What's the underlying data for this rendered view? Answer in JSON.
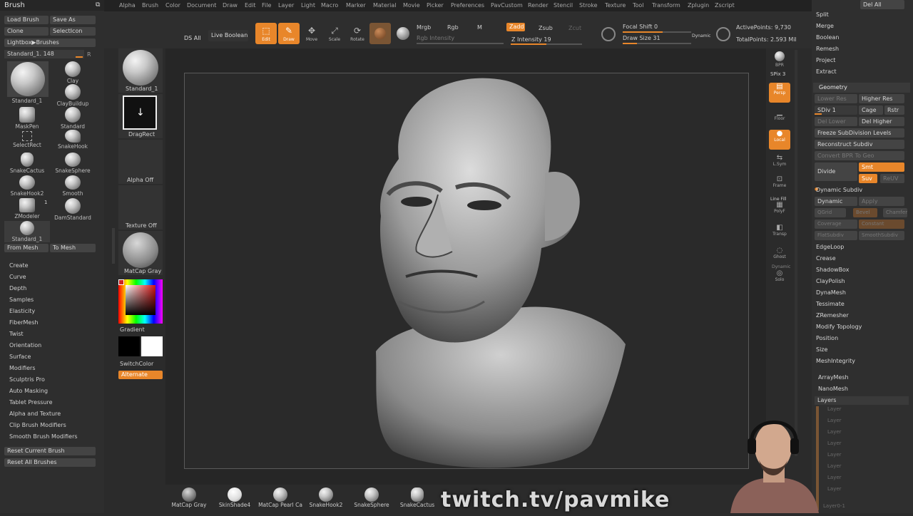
{
  "menu": [
    "Alpha",
    "Brush",
    "Color",
    "Document",
    "Draw",
    "Edit",
    "File",
    "Layer",
    "Light",
    "Macro",
    "Marker",
    "Material",
    "Movie",
    "Picker",
    "Preferences",
    "PavCustom",
    "Render",
    "Stencil",
    "Stroke",
    "Texture",
    "Tool",
    "Transform",
    "Zplugin",
    "Zscript"
  ],
  "left": {
    "title": "Brush",
    "load": "Load Brush",
    "saveas": "Save As",
    "clone": "Clone",
    "selecticon": "SelectIcon",
    "lightbox": "Lightbox▶Brushes",
    "current": "Standard_1. 148",
    "r": "R",
    "brushes": [
      "Standard_1",
      "Clay",
      "ClayBuildup",
      "MaskPen",
      "Standard",
      "SelectRect",
      "SnakeHook",
      "SnakeCactus",
      "SnakeSphere",
      "SnakeHook2",
      "Smooth",
      "ZModeler",
      "DamStandard",
      "Standard_1"
    ],
    "zmodeler_count": "1",
    "frommesh": "From Mesh",
    "tomesh": "To Mesh",
    "sections": [
      "Create",
      "Curve",
      "Depth",
      "Samples",
      "Elasticity",
      "FiberMesh",
      "Twist",
      "Orientation",
      "Surface",
      "Modifiers",
      "Sculptris Pro",
      "Auto Masking",
      "Tablet Pressure",
      "Alpha and Texture",
      "Clip Brush Modifiers",
      "Smooth Brush Modifiers"
    ],
    "reset_current": "Reset Current Brush",
    "reset_all": "Reset All Brushes"
  },
  "shelf": {
    "brush": "Standard_1",
    "stroke": "DragRect",
    "alpha": "Alpha Off",
    "texture": "Texture Off",
    "material": "MatCap Gray",
    "gradient": "Gradient",
    "switchcolor": "SwitchColor",
    "alternate": "Alternate"
  },
  "toolbar": {
    "ds_all": "DS All",
    "live_boolean": "Live Boolean",
    "edit": "Edit",
    "draw": "Draw",
    "move": "Move",
    "scale": "Scale",
    "rotate": "Rotate",
    "mrgb": "Mrgb",
    "rgb": "Rgb",
    "m": "M",
    "zadd": "Zadd",
    "zsub": "Zsub",
    "zcut": "Zcut",
    "rgb_intensity": "Rgb Intensity",
    "z_intensity": "Z Intensity 19",
    "focal": "Focal Shift 0",
    "drawsize": "Draw Size 31",
    "dynamic": "Dynamic",
    "active_points": "ActivePoints: 9,730",
    "total_points": "TotalPoints: 2.593 Mil"
  },
  "rightshelf": {
    "bpr": "BPR",
    "spix": "SPix 3",
    "persp": "Persp",
    "floor": "Floor",
    "local": "Local",
    "lsym": "L.Sym",
    "frame": "Frame",
    "polyf": "PolyF",
    "transp": "Transp",
    "ghost": "Ghost",
    "solo": "Solo",
    "dynamic": "Dynamic",
    "linefill": "Line Fill"
  },
  "right": {
    "delall": "Del All",
    "top_items": [
      "Split",
      "Merge",
      "Boolean",
      "Remesh",
      "Project",
      "Extract"
    ],
    "geometry": "Geometry",
    "lower_res": "Lower Res",
    "higher_res": "Higher Res",
    "sdiv": "SDiv 1",
    "cage": "Cage",
    "rstr": "Rstr",
    "del_lower": "Del Lower",
    "del_higher": "Del Higher",
    "freeze": "Freeze SubDivision Levels",
    "reconstruct": "Reconstruct Subdiv",
    "convert_bpr": "Convert BPR To Geo",
    "divide": "Divide",
    "smt": "Smt",
    "suv": "Suv",
    "reuv": "ReUV",
    "dynamic_subdiv": "Dynamic Subdiv",
    "dynamic": "Dynamic",
    "apply": "Apply",
    "qgrid": "QGrid",
    "bevel": "Bevel",
    "chamfer": "Chamfer",
    "coverage": "Coverage",
    "constant": "Constant",
    "flatsubdiv": "FlatSubdiv",
    "smoothsubdiv": "SmoothSubdiv",
    "list": [
      "EdgeLoop",
      "Crease",
      "ShadowBox",
      "ClayPolish",
      "DynaMesh",
      "Tessimate",
      "ZRemesher",
      "Modify Topology",
      "Position",
      "Size",
      "MeshIntegrity"
    ],
    "arraymesh": "ArrayMesh",
    "nanomesh": "NanoMesh",
    "layers": "Layers",
    "layer_label": "Layer",
    "layer_footer": "Layer0-1"
  },
  "bottom": [
    "MatCap Gray",
    "SkinShade4",
    "MatCap Pearl Ca",
    "SnakeHook2",
    "SnakeSphere",
    "SnakeCactus"
  ],
  "watermark": "twitch.tv/pavmike",
  "colors": {
    "accent": "#e8862a",
    "panel": "#2e2e2e",
    "button": "#444444"
  }
}
